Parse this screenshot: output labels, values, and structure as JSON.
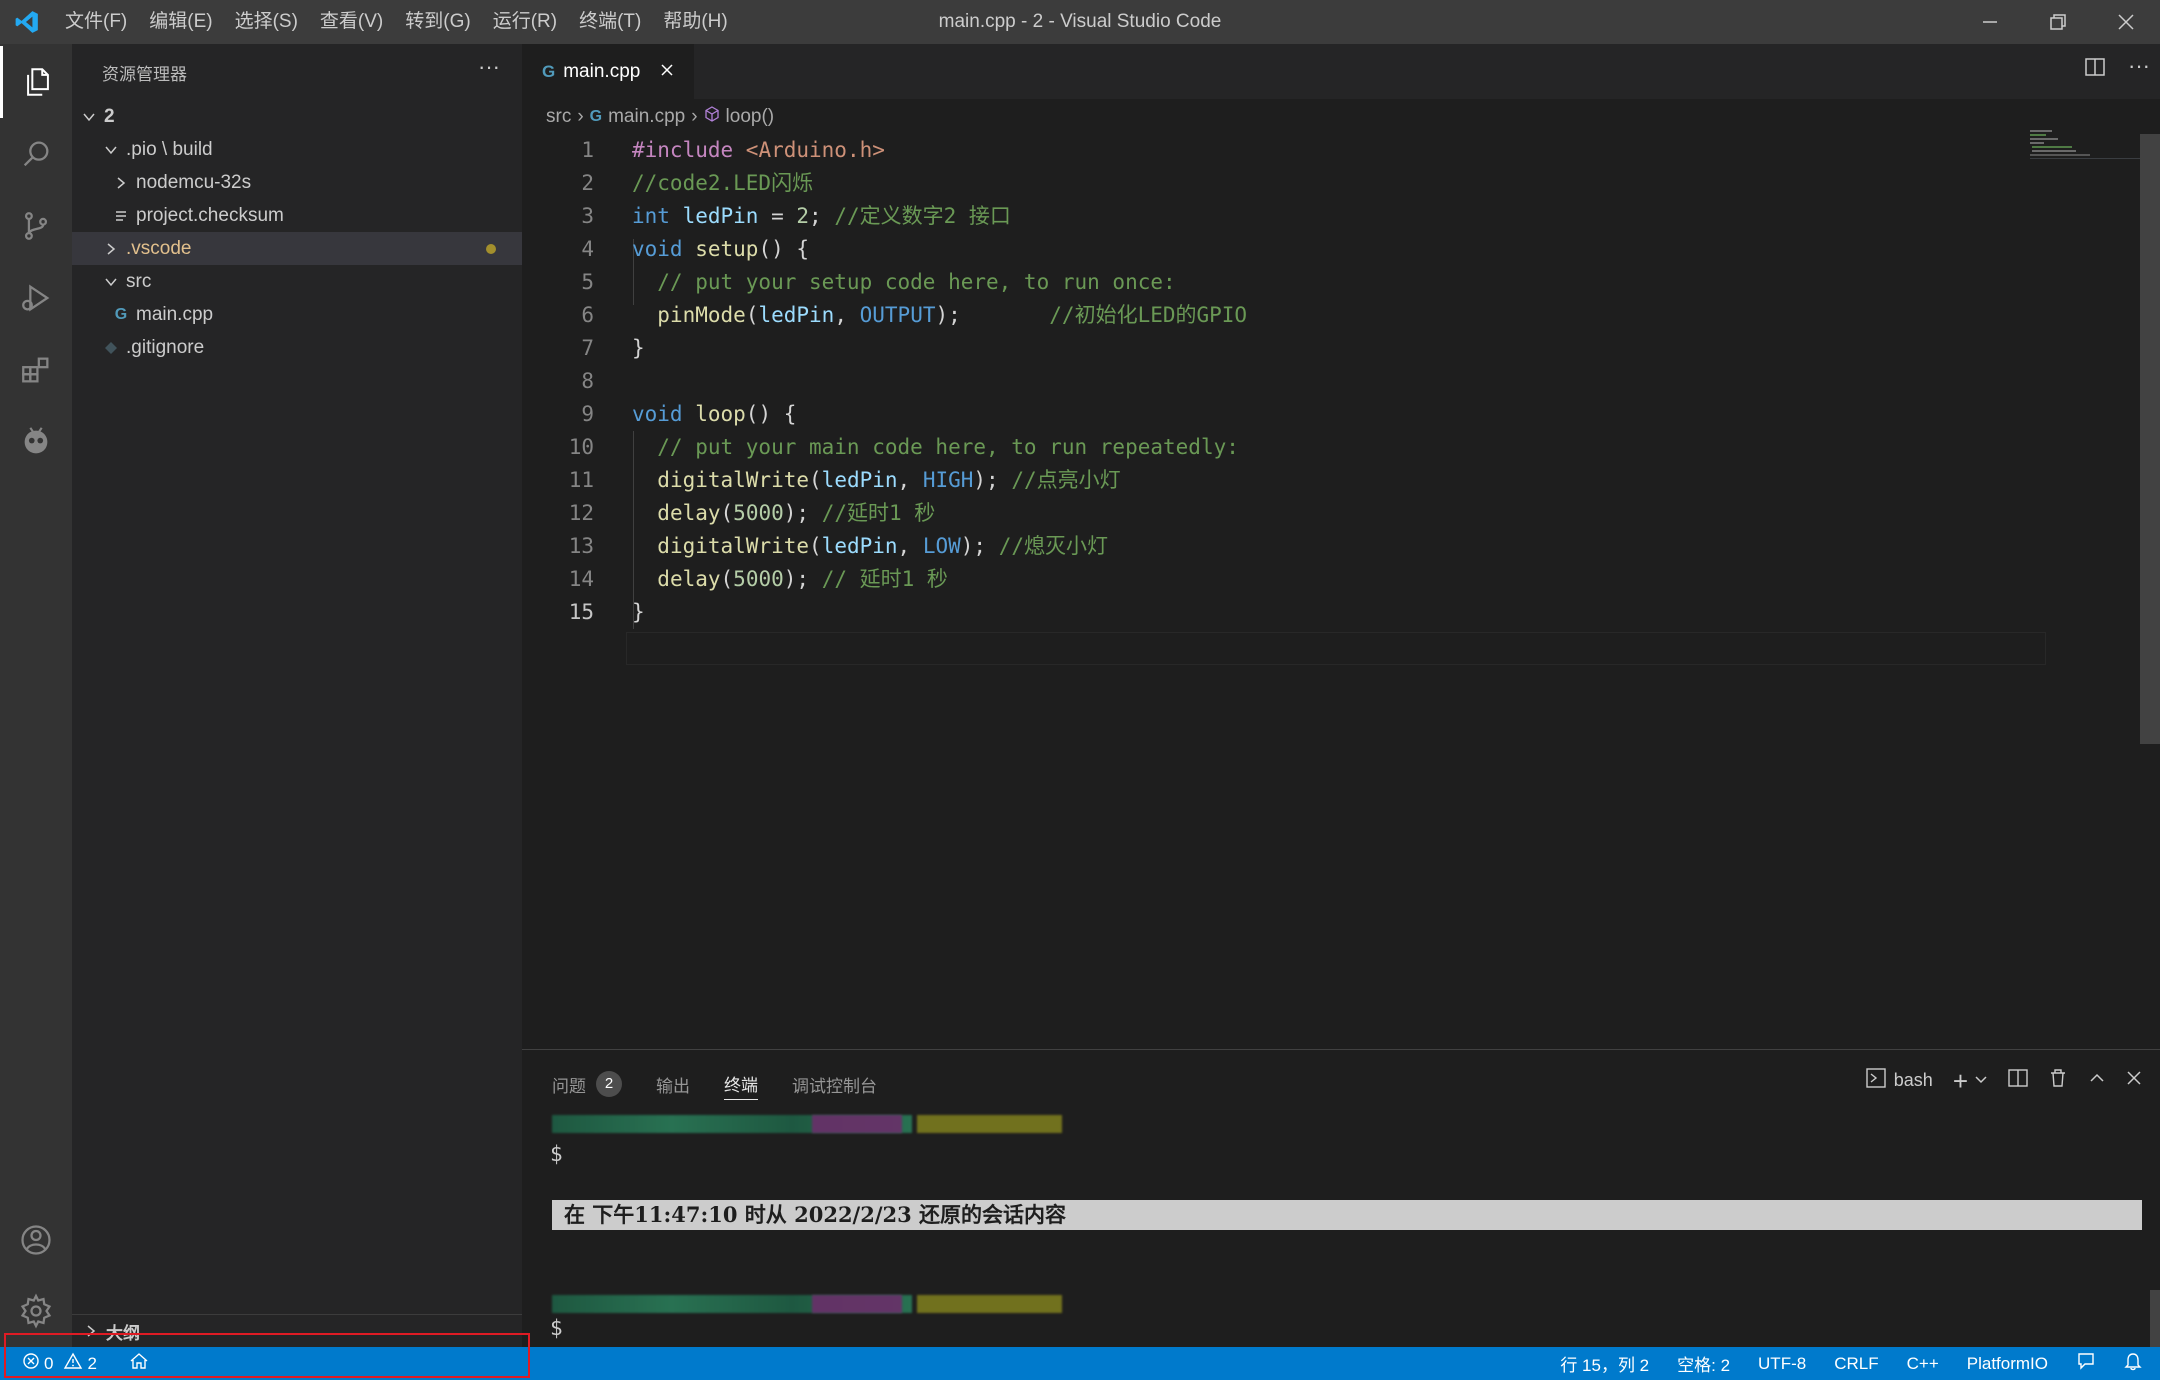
{
  "titlebar": {
    "menu": [
      "文件(F)",
      "编辑(E)",
      "选择(S)",
      "查看(V)",
      "转到(G)",
      "运行(R)",
      "终端(T)",
      "帮助(H)"
    ],
    "title": "main.cpp - 2 - Visual Studio Code"
  },
  "activity_bar": {
    "top": [
      "explorer-icon",
      "search-icon",
      "source-control-icon",
      "run-debug-icon",
      "extensions-icon",
      "platformio-icon"
    ],
    "bottom": [
      "account-icon",
      "settings-gear-icon"
    ]
  },
  "sidebar": {
    "title": "资源管理器",
    "more": "···",
    "tree": [
      {
        "label": "2",
        "kind": "folder-open"
      },
      {
        "label": ".pio \\ build",
        "kind": "folder-open"
      },
      {
        "label": "nodemcu-32s",
        "kind": "folder-closed"
      },
      {
        "label": "project.checksum",
        "kind": "file"
      },
      {
        "label": ".vscode",
        "kind": "folder-closed"
      },
      {
        "label": "src",
        "kind": "folder-open"
      },
      {
        "label": "main.cpp",
        "kind": "file-cpp"
      },
      {
        "label": ".gitignore",
        "kind": "file-git"
      }
    ],
    "outline_label": "大纲"
  },
  "editor": {
    "tab_label": "main.cpp",
    "breadcrumb": [
      "src",
      "main.cpp",
      "loop()"
    ],
    "current_line": 15,
    "lines": [
      [
        {
          "t": "#include ",
          "c": "#c586c0"
        },
        {
          "t": "<Arduino.h>",
          "c": "#ce9178"
        }
      ],
      [
        {
          "t": "//code2.LED闪烁",
          "c": "#6a9955"
        }
      ],
      [
        {
          "t": "int ",
          "c": "#569cd6"
        },
        {
          "t": "ledPin",
          "c": "#9cdcfe"
        },
        {
          "t": " = ",
          "c": "#d4d4d4"
        },
        {
          "t": "2",
          "c": "#b5cea8"
        },
        {
          "t": "; ",
          "c": "#d4d4d4"
        },
        {
          "t": "//定义数字2 接口",
          "c": "#6a9955"
        }
      ],
      [
        {
          "t": "void ",
          "c": "#569cd6"
        },
        {
          "t": "setup",
          "c": "#dcdcaa"
        },
        {
          "t": "() {",
          "c": "#d4d4d4"
        }
      ],
      [
        {
          "t": "  // put your setup code here, to run once:",
          "c": "#6a9955"
        }
      ],
      [
        {
          "t": "  ",
          "c": "#d4d4d4"
        },
        {
          "t": "pinMode",
          "c": "#dcdcaa"
        },
        {
          "t": "(",
          "c": "#d4d4d4"
        },
        {
          "t": "ledPin",
          "c": "#9cdcfe"
        },
        {
          "t": ", ",
          "c": "#d4d4d4"
        },
        {
          "t": "OUTPUT",
          "c": "#569cd6"
        },
        {
          "t": ");       ",
          "c": "#d4d4d4"
        },
        {
          "t": "//初始化LED的GPIO",
          "c": "#6a9955"
        }
      ],
      [
        {
          "t": "}",
          "c": "#d4d4d4"
        }
      ],
      [],
      [
        {
          "t": "void ",
          "c": "#569cd6"
        },
        {
          "t": "loop",
          "c": "#dcdcaa"
        },
        {
          "t": "() {",
          "c": "#d4d4d4"
        }
      ],
      [
        {
          "t": "  // put your main code here, to run repeatedly:",
          "c": "#6a9955"
        }
      ],
      [
        {
          "t": "  ",
          "c": "#d4d4d4"
        },
        {
          "t": "digitalWrite",
          "c": "#dcdcaa"
        },
        {
          "t": "(",
          "c": "#d4d4d4"
        },
        {
          "t": "ledPin",
          "c": "#9cdcfe"
        },
        {
          "t": ", ",
          "c": "#d4d4d4"
        },
        {
          "t": "HIGH",
          "c": "#569cd6"
        },
        {
          "t": "); ",
          "c": "#d4d4d4"
        },
        {
          "t": "//点亮小灯",
          "c": "#6a9955"
        }
      ],
      [
        {
          "t": "  ",
          "c": "#d4d4d4"
        },
        {
          "t": "delay",
          "c": "#dcdcaa"
        },
        {
          "t": "(",
          "c": "#d4d4d4"
        },
        {
          "t": "5000",
          "c": "#b5cea8"
        },
        {
          "t": "); ",
          "c": "#d4d4d4"
        },
        {
          "t": "//延时1 秒",
          "c": "#6a9955"
        }
      ],
      [
        {
          "t": "  ",
          "c": "#d4d4d4"
        },
        {
          "t": "digitalWrite",
          "c": "#dcdcaa"
        },
        {
          "t": "(",
          "c": "#d4d4d4"
        },
        {
          "t": "ledPin",
          "c": "#9cdcfe"
        },
        {
          "t": ", ",
          "c": "#d4d4d4"
        },
        {
          "t": "LOW",
          "c": "#569cd6"
        },
        {
          "t": "); ",
          "c": "#d4d4d4"
        },
        {
          "t": "//熄灭小灯",
          "c": "#6a9955"
        }
      ],
      [
        {
          "t": "  ",
          "c": "#d4d4d4"
        },
        {
          "t": "delay",
          "c": "#dcdcaa"
        },
        {
          "t": "(",
          "c": "#d4d4d4"
        },
        {
          "t": "5000",
          "c": "#b5cea8"
        },
        {
          "t": "); ",
          "c": "#d4d4d4"
        },
        {
          "t": "// 延时1 秒",
          "c": "#6a9955"
        }
      ],
      [
        {
          "t": "}",
          "c": "#d4d4d4"
        }
      ]
    ]
  },
  "panel": {
    "tabs": [
      {
        "label": "问题",
        "badge": "2"
      },
      {
        "label": "输出"
      },
      {
        "label": "终端",
        "active": true
      },
      {
        "label": "调试控制台"
      }
    ],
    "shell": "bash",
    "prompt": "$",
    "restore_message": "在 下午11:47:10 时从 2022/2/23 还原的会话内容"
  },
  "statusbar": {
    "errors": "0",
    "warnings": "2",
    "position": "行 15，列 2",
    "indent": "空格: 2",
    "encoding": "UTF-8",
    "eol": "CRLF",
    "language": "C++",
    "extension": "PlatformIO"
  },
  "colors": {
    "accent": "#007acc",
    "highlight": "#e01b24",
    "modified_dot": "#a38f2d",
    "vscode_folder_text": "#e2c08d"
  }
}
